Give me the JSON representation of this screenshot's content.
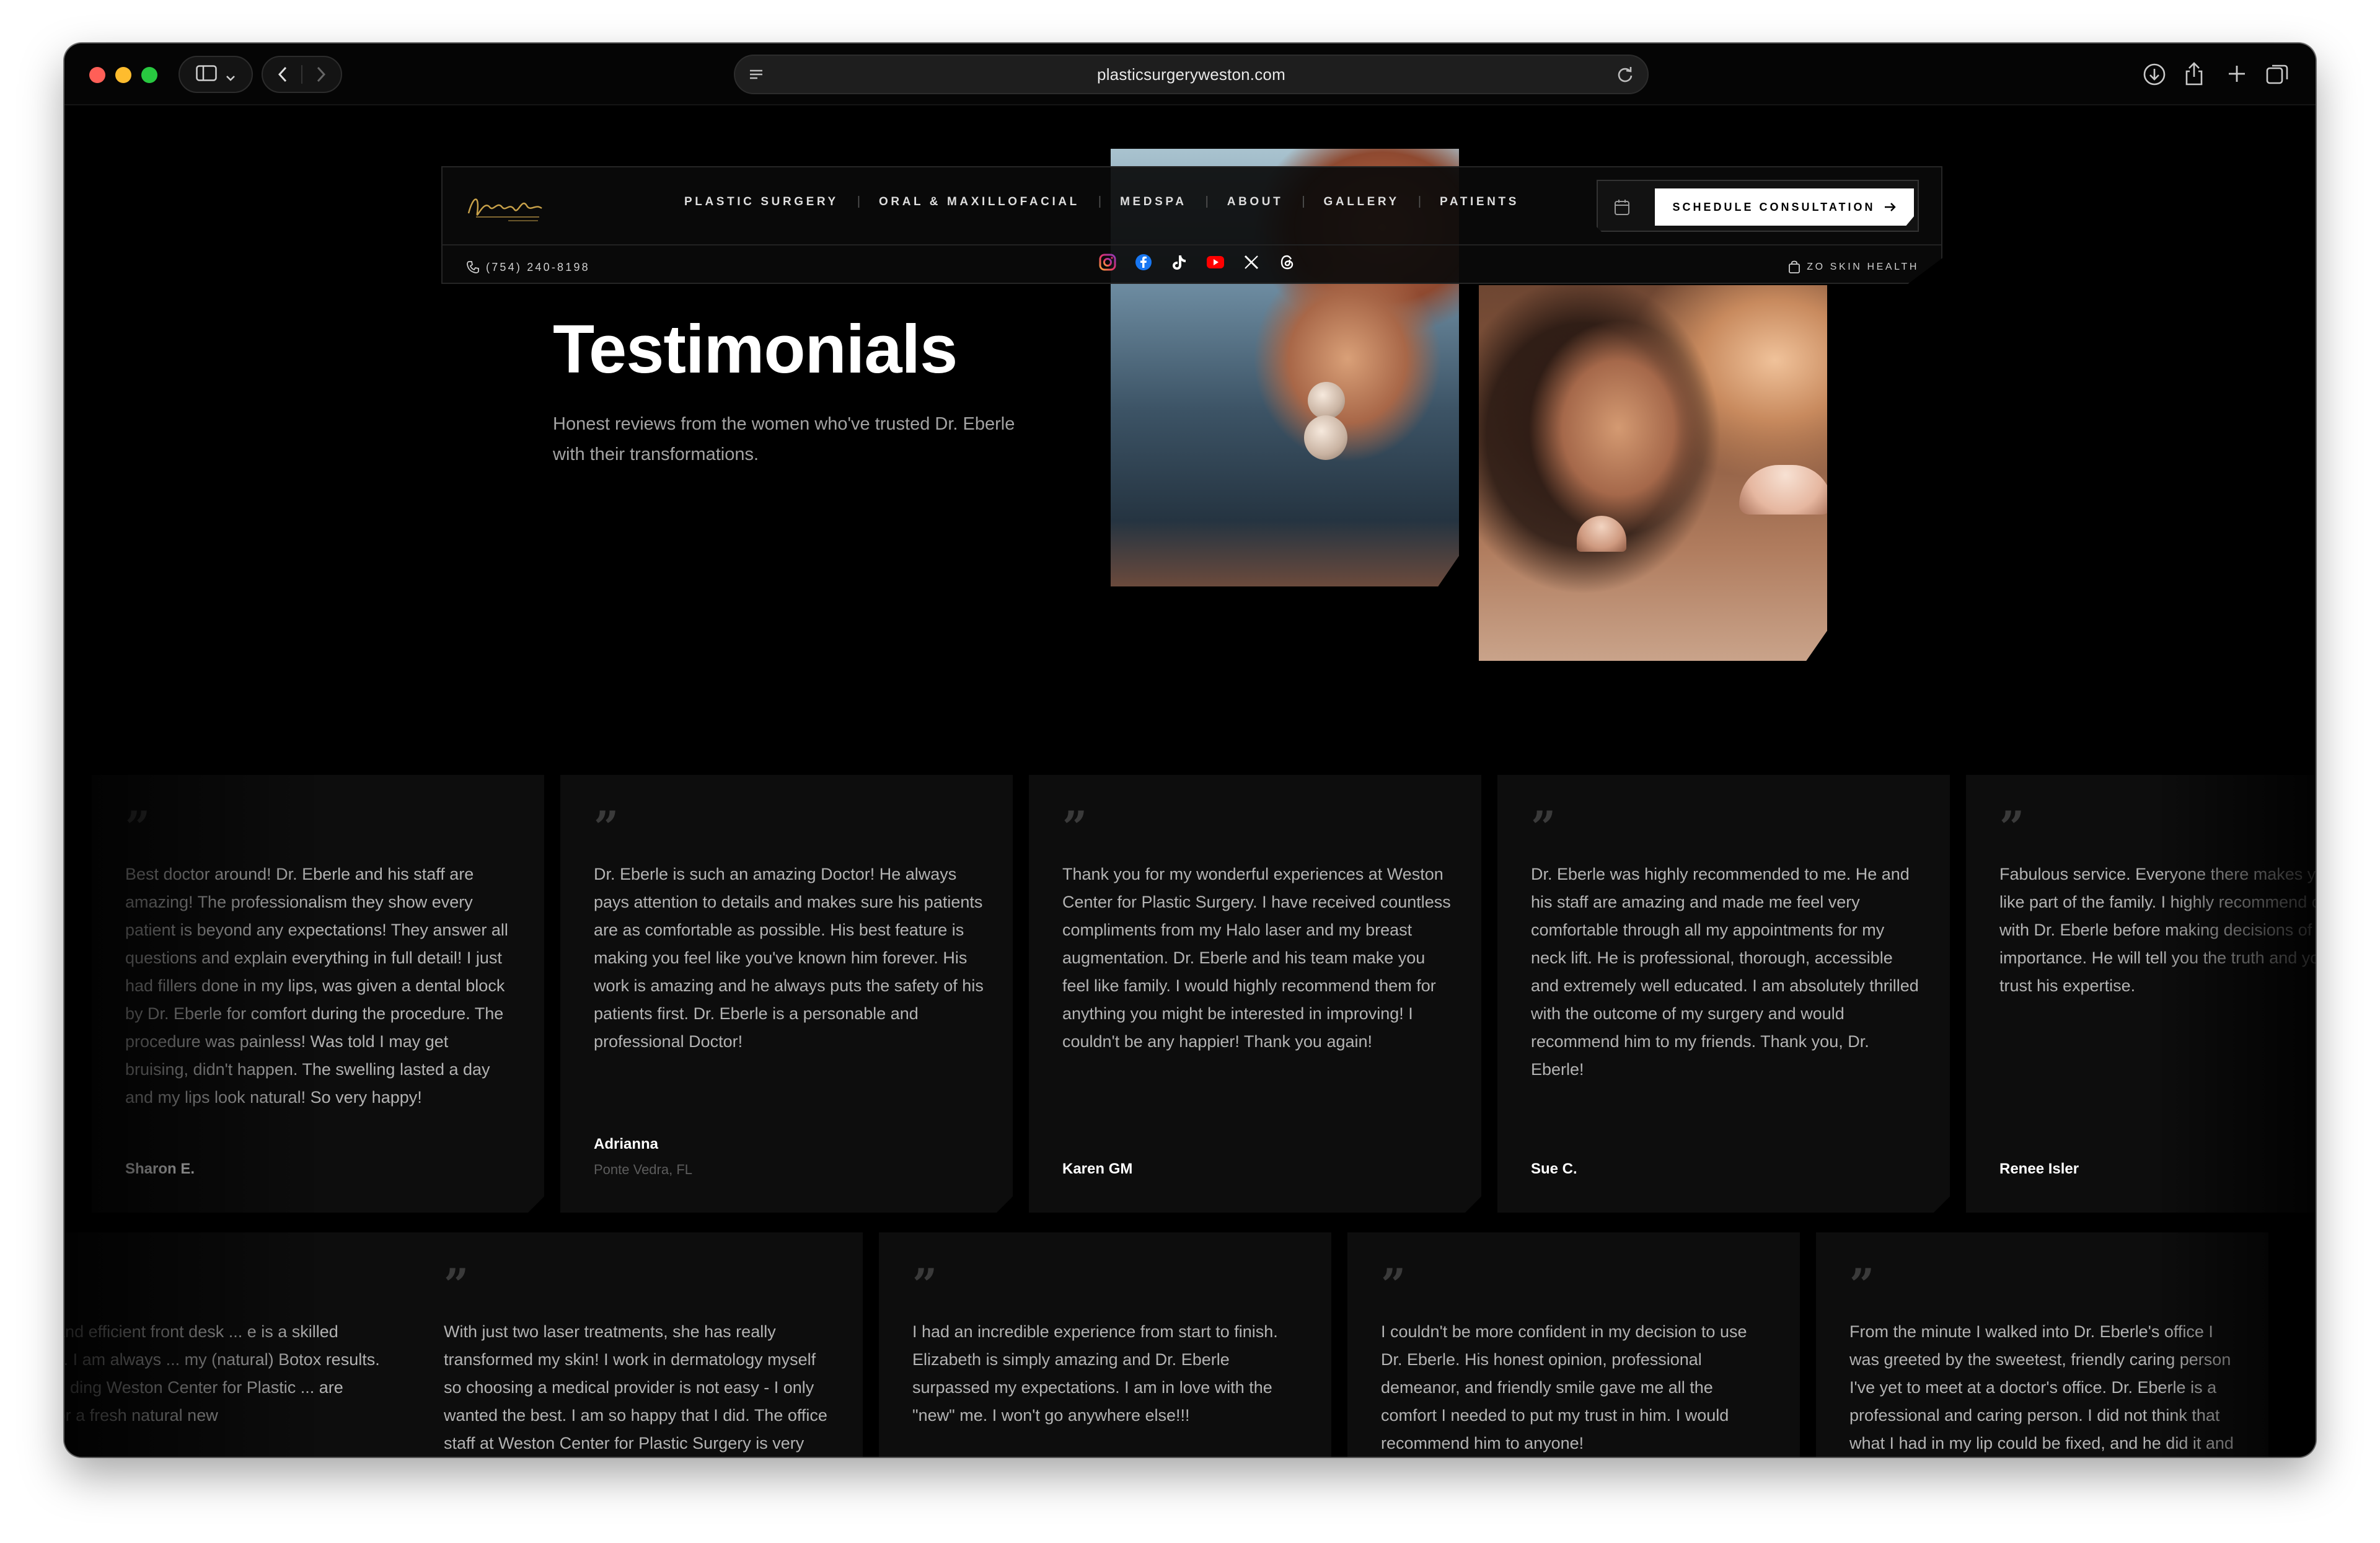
{
  "browser": {
    "url": "plasticsurgeryweston.com"
  },
  "header": {
    "nav": [
      "PLASTIC SURGERY",
      "ORAL & MAXILLOFACIAL",
      "MEDSPA",
      "ABOUT",
      "GALLERY",
      "PATIENTS"
    ],
    "cta_label": "SCHEDULE CONSULTATION",
    "phone": "(754) 240-8198",
    "zo_link": "ZO SKIN HEALTH",
    "socials": [
      "instagram-icon",
      "facebook-icon",
      "tiktok-icon",
      "youtube-icon",
      "x-icon",
      "threads-icon"
    ]
  },
  "hero": {
    "title": "Testimonials",
    "subtitle_line1": "Honest reviews from the women who've trusted Dr. Eberle",
    "subtitle_line2": "with their transformations."
  },
  "testimonials_row1": [
    {
      "text": "Best doctor around! Dr. Eberle and his staff are amazing! The professionalism they show every patient is beyond any expectations! They answer all questions and explain everything in full detail! I just had fillers done in my lips, was given a dental block by Dr. Eberle for comfort during the procedure. The procedure was painless! Was told I may get bruising, didn't happen. The swelling lasted a day and my lips look natural! So very happy!",
      "author": "Sharon E.",
      "location": ""
    },
    {
      "text": "Dr. Eberle is such an amazing Doctor! He always pays attention to details and makes sure his patients are as comfortable as possible. His best feature is making you feel like you've known him forever. His work is amazing and he always puts the safety of his patients first. Dr. Eberle is a personable and professional Doctor!",
      "author": "Adrianna",
      "location": "Ponte Vedra, FL"
    },
    {
      "text": "Thank you for my wonderful experiences at Weston Center for Plastic Surgery. I have received countless compliments from my Halo laser and my breast augmentation. Dr. Eberle and his team make you feel like family. I would highly recommend them for anything you might be interested in improving! I couldn't be any happier! Thank you again!",
      "author": "Karen GM",
      "location": ""
    },
    {
      "text": "Dr. Eberle was highly recommended to me. He and his staff are amazing and made me feel very comfortable through all my appointments for my neck lift. He is professional, thorough, accessible and extremely well educated. I am absolutely thrilled with the outcome of my surgery and would recommend him to my friends. Thank you, Dr. Eberle!",
      "author": "Sue C.",
      "location": ""
    },
    {
      "text": "Fabulous service. Everyone there makes you feel like part of the family. I highly recommend consulting with Dr. Eberle before making decisions of such importance. He will tell you the truth and you can trust his expertise.",
      "author": "Renee Isler",
      "location": ""
    }
  ],
  "testimonials_row2": [
    {
      "text": "friendly, and efficient front desk ... e is a skilled physician. I am always ... my (natural) Botox results. I highly ... ding Weston Center for Plastic ... are looking for a fresh natural new"
    },
    {
      "text": "With just two laser treatments, she has really transformed my skin! I work in dermatology myself so choosing a medical provider is not easy - I only wanted the best. I am so happy that I did. The office staff at Weston Center for Plastic Surgery is very professional and kind. They have wonderful lasers (one of which I don't even have"
    },
    {
      "text": "I had an incredible experience from start to finish. Elizabeth is simply amazing and Dr. Eberle surpassed my expectations. I am in love with the \"new\" me. I won't go anywhere else!!!"
    },
    {
      "text": "I couldn't be more confident in my decision to use Dr. Eberle. His honest opinion, professional demeanor, and friendly smile gave me all the comfort I needed to put my trust in him. I would recommend him to anyone!"
    },
    {
      "text": "From the minute I walked into Dr. Eberle's office I was greeted by the sweetest, friendly caring person I've yet to meet at a doctor's office. Dr. Eberle is a professional and caring person. I did not think that what I had in my lip could be fixed, and he did it and did an excellent job with very little time before my son's wedding. I highly"
    }
  ],
  "colors": {
    "background": "#000000",
    "card": "#0d0d0d",
    "accent_logo": "#c9a24a",
    "text_muted": "#b3b3b3"
  }
}
